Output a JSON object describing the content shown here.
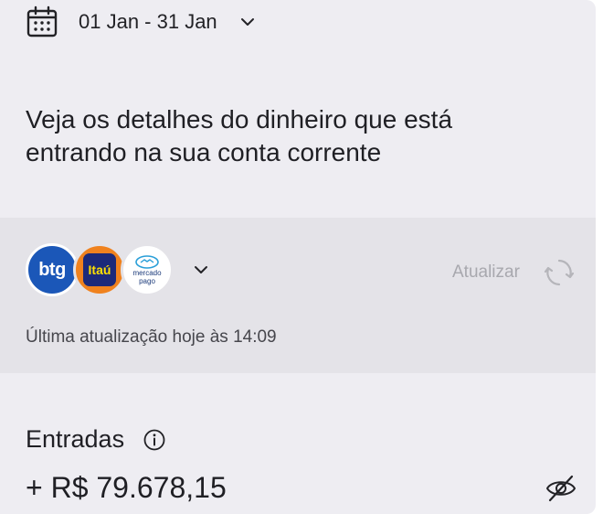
{
  "period": {
    "range_label": "01 Jan - 31 Jan",
    "calendar_icon": "calendar-icon",
    "dropdown_icon": "chevron-down-icon"
  },
  "intro": {
    "text": "Veja os detalhes do dinheiro que está entrando na sua conta corrente"
  },
  "banks": {
    "items": [
      {
        "name": "btg",
        "label": "btg",
        "color": "#1b57b8"
      },
      {
        "name": "itau",
        "label": "Itaú",
        "color": "#f0821e"
      },
      {
        "name": "mercado-pago",
        "label_line1": "mercado",
        "label_line2": "pago",
        "color": "#ffffff"
      }
    ],
    "expand_icon": "chevron-down-icon",
    "refresh_label": "Atualizar",
    "refresh_icon": "refresh-icon",
    "last_update": "Última atualização hoje às 14:09"
  },
  "incoming": {
    "label": "Entradas",
    "info_icon": "info-icon",
    "amount": "+ R$ 79.678,15",
    "visibility_icon": "eye-off-icon"
  },
  "colors": {
    "background": "#eeedf2",
    "band": "#e4e3e8",
    "text": "#1f1f24",
    "muted": "#a8a8ae"
  }
}
